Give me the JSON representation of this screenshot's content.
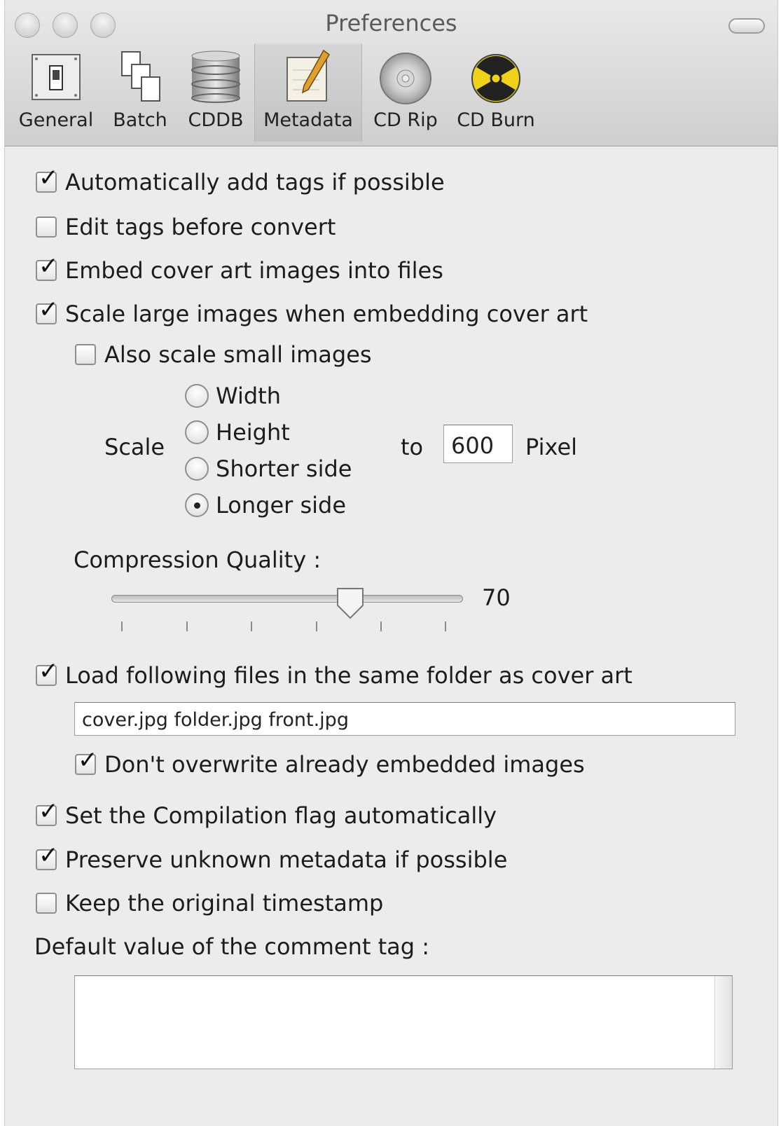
{
  "window": {
    "title": "Preferences"
  },
  "toolbar": {
    "items": [
      {
        "label": "General",
        "icon": "switch-panel-icon"
      },
      {
        "label": "Batch",
        "icon": "documents-icon"
      },
      {
        "label": "CDDB",
        "icon": "database-icon"
      },
      {
        "label": "Metadata",
        "icon": "pencil-note-icon",
        "selected": true
      },
      {
        "label": "CD Rip",
        "icon": "cd-disc-icon"
      },
      {
        "label": "CD Burn",
        "icon": "radiation-icon"
      }
    ]
  },
  "options": {
    "auto_add_tags": {
      "label": "Automatically add tags if possible",
      "checked": true
    },
    "edit_tags": {
      "label": "Edit tags before convert",
      "checked": false
    },
    "embed_cover": {
      "label": "Embed cover art images into files",
      "checked": true
    },
    "scale_large": {
      "label": "Scale large images when embedding cover art",
      "checked": true
    },
    "scale_small": {
      "label": "Also scale small images",
      "checked": false
    },
    "load_files": {
      "label": "Load following files in the same folder as cover art",
      "checked": true
    },
    "dont_overwrite": {
      "label": "Don't overwrite already embedded images",
      "checked": true
    },
    "compilation": {
      "label": "Set the Compilation flag automatically",
      "checked": true
    },
    "preserve_unknown": {
      "label": "Preserve unknown metadata if possible",
      "checked": true
    },
    "keep_timestamp": {
      "label": "Keep the original timestamp",
      "checked": false
    }
  },
  "scale": {
    "label": "Scale",
    "to_label": "to",
    "value": "600",
    "unit": "Pixel",
    "radios": [
      {
        "label": "Width",
        "selected": false
      },
      {
        "label": "Height",
        "selected": false
      },
      {
        "label": "Shorter side",
        "selected": false
      },
      {
        "label": "Longer side",
        "selected": true
      }
    ]
  },
  "compression": {
    "label": "Compression Quality :",
    "value": "70",
    "level_fraction": 0.68
  },
  "cover_files": {
    "value": "cover.jpg folder.jpg front.jpg"
  },
  "comment": {
    "label": "Default value of the comment tag :",
    "value": ""
  },
  "colors": {
    "window_bg": "#ececec",
    "toolbar_selected": "#c8c8c8"
  }
}
